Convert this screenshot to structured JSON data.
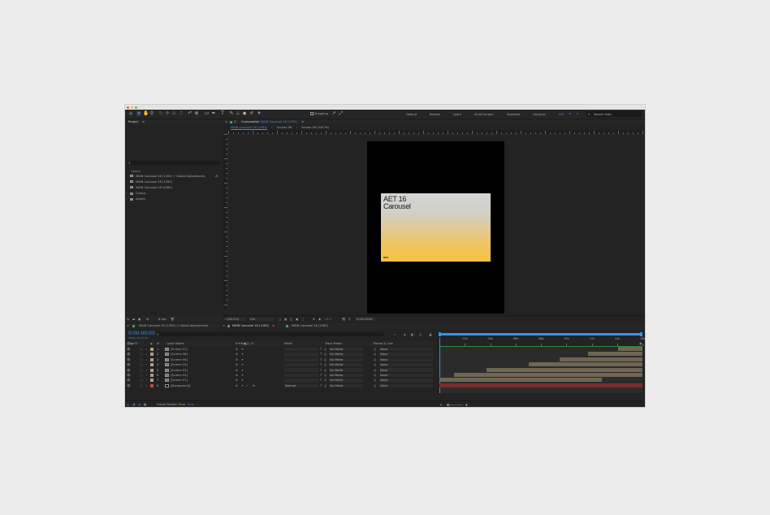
{
  "colors": {
    "accent": "#3d8ee8",
    "panel_bg": "#232323",
    "viewer_bg": "#000000",
    "label_tan": "#b59d80",
    "label_red": "#c24a44",
    "bar_tan": "#6f6554",
    "bar_red": "#7a2e2d",
    "comp_green": "#3fa35a"
  },
  "toolbar": {
    "snapping_label": "Snapping",
    "workspaces": [
      "Default",
      "Review",
      "Learn",
      "Small Screen",
      "Standard",
      "Libraries",
      "AET"
    ],
    "active_workspace": "AET",
    "search_placeholder": "Search Help"
  },
  "project": {
    "title": "Project",
    "column_name": "Name",
    "items": [
      {
        "label": "MAIN Carousel 16 (1350) + Global Adjustments",
        "icon": "composition-icon"
      },
      {
        "label": "MAIN Carousel 16 (1350)",
        "icon": "composition-icon"
      },
      {
        "label": "MAIN Carousel 16 (1080)",
        "icon": "composition-icon"
      },
      {
        "label": "Comps",
        "icon": "folder-icon"
      },
      {
        "label": "Assets",
        "icon": "folder-icon"
      }
    ],
    "bpc": "8 bpc"
  },
  "composition": {
    "panel_prefix": "Composition",
    "comp_name": "MAIN Carousel 16 (1350)",
    "breadcrumbs": [
      "MAIN Carousel 16 (1350)",
      "Screen 06",
      "Screen 06 (530 Ps)"
    ],
    "zoom": "(84.2%)",
    "resolution": "Full",
    "exposure": "+0.0",
    "timecode": "0:00:00:00",
    "card_title_line1": "AET 16",
    "card_title_line2": "Carousel",
    "card_logo": "aeo"
  },
  "timeline": {
    "tabs": [
      "MAIN Carousel 16 (1350) + Global Adjustments",
      "MAIN Carousel 16 (1350)",
      "MAIN Carousel 16 (1080)"
    ],
    "active_tab": 1,
    "timecode": "0:00:00:00",
    "fps": "00000 (30.00 fps)",
    "columns": {
      "num": "#",
      "layer_name": "Layer Name",
      "mode": "Mode",
      "track_matte": "Track Matte",
      "parent": "Parent & Link"
    },
    "layers": [
      {
        "num": "1",
        "name": "[Screen 01]",
        "mode": "",
        "matte": "No Matte",
        "parent": "None",
        "color": "tan",
        "start": 0.88
      },
      {
        "num": "2",
        "name": "[Screen 06]",
        "mode": "",
        "matte": "No Matte",
        "parent": "None",
        "color": "tan",
        "start": 0.73
      },
      {
        "num": "3",
        "name": "[Screen 05]",
        "mode": "",
        "matte": "No Matte",
        "parent": "None",
        "color": "tan",
        "start": 0.59
      },
      {
        "num": "4",
        "name": "[Screen 04]",
        "mode": "",
        "matte": "No Matte",
        "parent": "None",
        "color": "tan",
        "start": 0.44
      },
      {
        "num": "5",
        "name": "[Screen 03]",
        "mode": "",
        "matte": "No Matte",
        "parent": "None",
        "color": "tan",
        "start": 0.23
      },
      {
        "num": "6",
        "name": "[Screen 02]",
        "mode": "",
        "matte": "No Matte",
        "parent": "None",
        "color": "tan",
        "start": 0.07
      },
      {
        "num": "7",
        "name": "[Screen 01]",
        "mode": "",
        "matte": "No Matte",
        "parent": "None",
        "color": "tan",
        "start": 0.0,
        "end": 0.8
      },
      {
        "num": "8",
        "name": "[Background]",
        "mode": "Normal",
        "matte": "No Matte",
        "parent": "None",
        "color": "red",
        "start": 0.0
      }
    ],
    "ruler_labels": [
      "",
      "02s",
      "04s",
      "06s",
      "08s",
      "10s",
      "12s",
      "14s",
      "16s"
    ],
    "footer_label": "Frame Render Time",
    "footer_value": "0ms"
  }
}
